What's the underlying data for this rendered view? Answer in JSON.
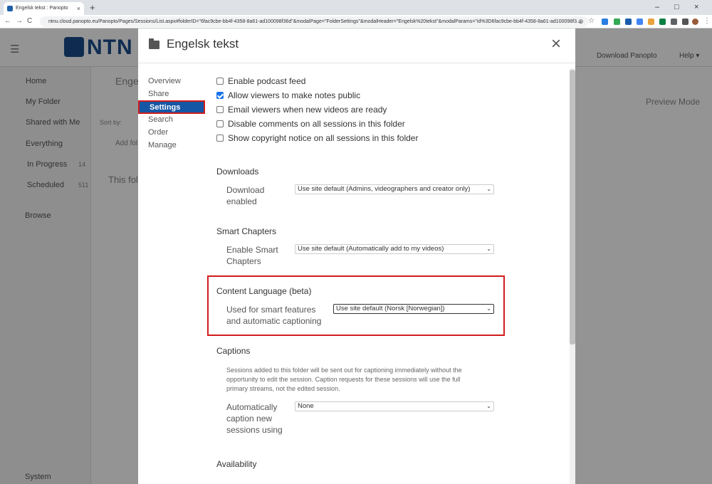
{
  "browser": {
    "tab_title": "Engelsk tekst : Panopto",
    "tab_close": "×",
    "new_tab": "+",
    "url": "ntnu.cloud.panopto.eu/Panopto/Pages/Sessions/List.aspx#folderID=\"6fac9cbe-bb4f-4358-8a61-ad100098f36d\"&modalPage=\"FolderSettings\"&modalHeader=\"Engelsk%20tekst\"&modalParams=\"id%3D6fac9cbe-bb4f-4358-8a61-ad100098f3...",
    "back": "←",
    "forward": "→",
    "reload": "C",
    "minimize": "–",
    "maximize": "□",
    "close": "×",
    "bookmark_star": "☆",
    "zoom_icon": "⊕",
    "menu_dots": "⋮"
  },
  "app": {
    "logo": "NTN",
    "download_link": "Download Panopto",
    "help_link": "Help ▾",
    "preview_mode": "Preview Mode",
    "sort_by": "Sort by:",
    "add_folder": "Add fol",
    "empty_msg": "This fol",
    "folder_crumb": "Engel",
    "sidebar": [
      {
        "label": "Home",
        "count": ""
      },
      {
        "label": "My Folder",
        "count": ""
      },
      {
        "label": "Shared with Me",
        "count": ""
      },
      {
        "label": "Everything",
        "count": ""
      },
      {
        "label": "In Progress",
        "count": "14"
      },
      {
        "label": "Scheduled",
        "count": "511"
      },
      {
        "label": "Browse",
        "count": ""
      },
      {
        "label": "System",
        "count": ""
      }
    ]
  },
  "modal": {
    "title": "Engelsk tekst",
    "close": "×",
    "nav": [
      "Overview",
      "Share",
      "Settings",
      "Search",
      "Order",
      "Manage"
    ],
    "checkboxes": [
      {
        "label": "Enable podcast feed",
        "checked": false
      },
      {
        "label": "Allow viewers to make notes public",
        "checked": true
      },
      {
        "label": "Email viewers when new videos are ready",
        "checked": false
      },
      {
        "label": "Disable comments on all sessions in this folder",
        "checked": false
      },
      {
        "label": "Show copyright notice on all sessions in this folder",
        "checked": false
      }
    ],
    "downloads": {
      "heading": "Downloads",
      "label_1": "Download",
      "label_2": "enabled",
      "value": "Use site default (Admins, videographers and creator only)"
    },
    "smart_chapters": {
      "heading": "Smart Chapters",
      "label_1": "Enable Smart",
      "label_2": "Chapters",
      "value": "Use site default (Automatically add to my videos)"
    },
    "content_language": {
      "heading": "Content Language (beta)",
      "label_1": "Used for smart features",
      "label_2": "and automatic captioning",
      "value": "Use site default (Norsk [Norwegian])"
    },
    "captions": {
      "heading": "Captions",
      "desc": "Sessions added to this folder will be sent out for captioning immediately without the opportunity to edit the session. Caption requests for these sessions will use the full primary streams, not the edited session.",
      "label_1": "Automatically",
      "label_2": "caption new",
      "label_3": "sessions using",
      "value": "None"
    },
    "availability": {
      "heading": "Availability"
    }
  }
}
